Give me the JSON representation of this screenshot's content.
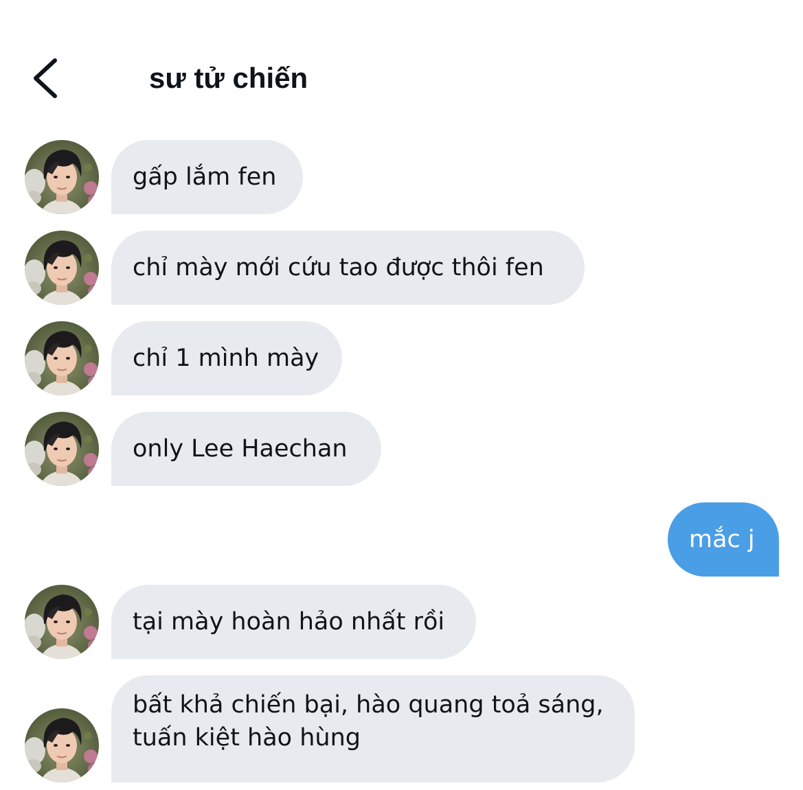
{
  "header": {
    "title": "sư tử chiến",
    "back_icon": "chevron-left-icon"
  },
  "colors": {
    "incoming_bubble": "#e7ebef",
    "outgoing_bubble": "#4a9ee6",
    "text": "#0f1419"
  },
  "messages": [
    {
      "direction": "incoming",
      "text": "gấp lắm fen"
    },
    {
      "direction": "incoming",
      "text": "chỉ mày mới cứu tao được thôi fen"
    },
    {
      "direction": "incoming",
      "text": "chỉ 1 mình mày"
    },
    {
      "direction": "incoming",
      "text": "only Lee Haechan"
    },
    {
      "direction": "outgoing",
      "text": "mắc j"
    },
    {
      "direction": "incoming",
      "text": "tại mày hoàn hảo nhất rồi"
    },
    {
      "direction": "incoming",
      "text": "bất khả chiến bại, hào quang toả sáng, tuấn kiệt hào hùng"
    }
  ]
}
